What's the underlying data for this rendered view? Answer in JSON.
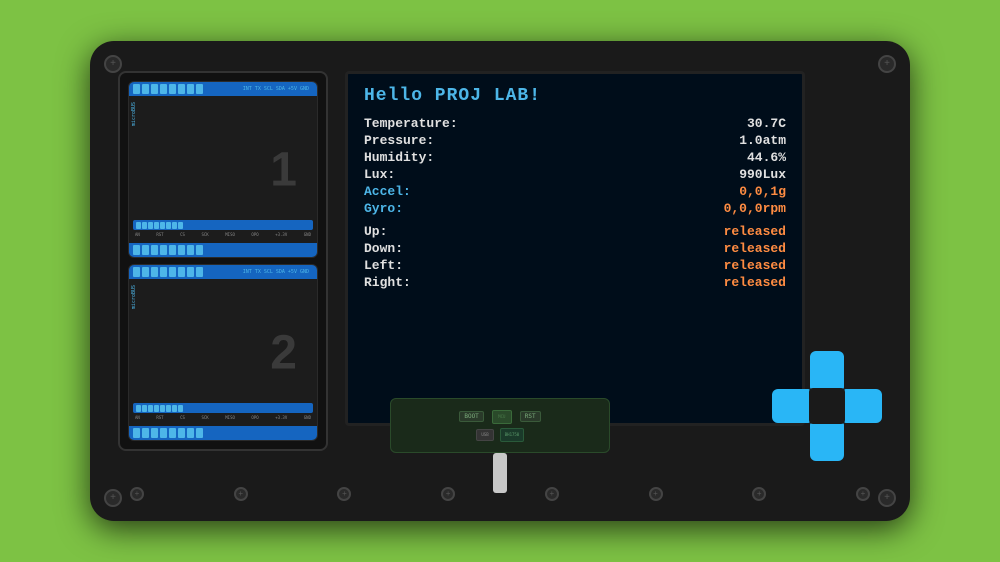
{
  "device": {
    "screen": {
      "title": "Hello PROJ LAB!",
      "rows": [
        {
          "label": "Temperature:",
          "value": "30.7C",
          "label_color": "white",
          "value_color": "white"
        },
        {
          "label": "Pressure:",
          "value": "1.0atm",
          "label_color": "white",
          "value_color": "white"
        },
        {
          "label": "Humidity:",
          "value": "44.6%",
          "label_color": "white",
          "value_color": "white"
        },
        {
          "label": "Lux:",
          "value": "990Lux",
          "label_color": "white",
          "value_color": "white"
        },
        {
          "label": "Accel:",
          "value": "0,0,1g",
          "label_color": "cyan",
          "value_color": "orange"
        },
        {
          "label": "Gyro:",
          "value": "0,0,0rpm",
          "label_color": "cyan",
          "value_color": "orange"
        },
        {
          "label": "Up:",
          "value": "released",
          "label_color": "white",
          "value_color": "orange"
        },
        {
          "label": "Down:",
          "value": "released",
          "label_color": "white",
          "value_color": "orange"
        },
        {
          "label": "Left:",
          "value": "released",
          "label_color": "white",
          "value_color": "orange"
        },
        {
          "label": "Right:",
          "value": "released",
          "label_color": "white",
          "value_color": "orange"
        }
      ]
    },
    "modules": [
      {
        "number": "1",
        "bus_label": "microBUS"
      },
      {
        "number": "2",
        "bus_label": "microBUS"
      }
    ],
    "board": {
      "boot_label": "BOOT",
      "rst_label": "RST",
      "usb_label": "USB",
      "chip_label": "BH1750"
    },
    "dpad": {
      "up_label": "▲",
      "down_label": "▼",
      "left_label": "◀",
      "right_label": "▶"
    }
  }
}
